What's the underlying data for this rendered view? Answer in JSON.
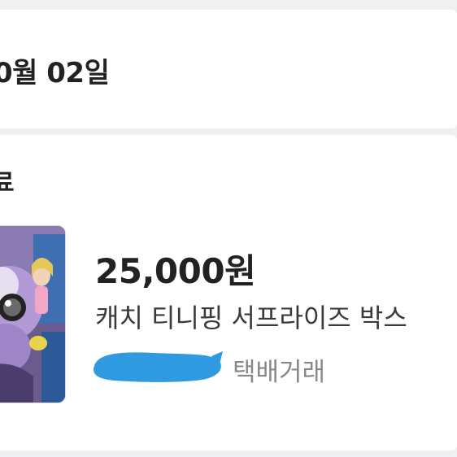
{
  "header": {
    "date": "0월 02일"
  },
  "transaction": {
    "status": "료",
    "price": "25,000원",
    "title": "캐치 티니핑 서프라이즈 박스",
    "delivery_method": "택배거래"
  },
  "colors": {
    "background": "#eef0f2",
    "card": "#ffffff",
    "text_primary": "#222222",
    "text_secondary": "#888888",
    "redaction": "#2f9ae0"
  },
  "icons": {
    "thumbnail": "toy-photo",
    "redaction": "blue-scribble"
  }
}
